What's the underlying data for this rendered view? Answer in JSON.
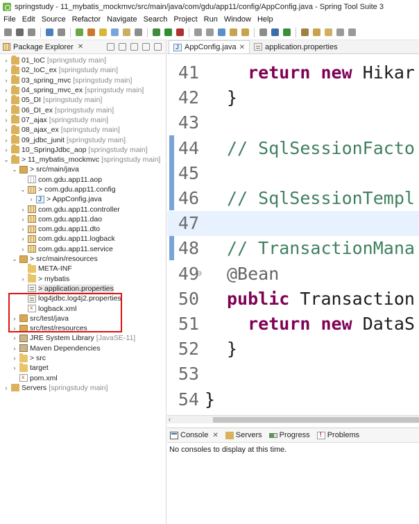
{
  "window": {
    "title": "springstudy - 11_mybatis_mockmvc/src/main/java/com/gdu/app11/config/AppConfig.java - Spring Tool Suite 3"
  },
  "menu": [
    "File",
    "Edit",
    "Source",
    "Refactor",
    "Navigate",
    "Search",
    "Project",
    "Run",
    "Window",
    "Help"
  ],
  "package_explorer": {
    "tab_label": "Package Explorer",
    "tree": [
      {
        "depth": 0,
        "twisty": ">",
        "icon": "project-icon",
        "label": "01_IoC",
        "deco": "[springstudy main]"
      },
      {
        "depth": 0,
        "twisty": ">",
        "icon": "project-icon",
        "label": "02_IoC_ex",
        "deco": "[springstudy main]"
      },
      {
        "depth": 0,
        "twisty": ">",
        "icon": "project-icon",
        "label": "03_spring_mvc",
        "deco": "[springstudy main]"
      },
      {
        "depth": 0,
        "twisty": ">",
        "icon": "project-icon",
        "label": "04_spring_mvc_ex",
        "deco": "[springstudy main]"
      },
      {
        "depth": 0,
        "twisty": ">",
        "icon": "project-icon",
        "label": "05_DI",
        "deco": "[springstudy main]"
      },
      {
        "depth": 0,
        "twisty": ">",
        "icon": "project-icon",
        "label": "06_DI_ex",
        "deco": "[springstudy main]"
      },
      {
        "depth": 0,
        "twisty": ">",
        "icon": "project-icon",
        "label": "07_ajax",
        "deco": "[springstudy main]"
      },
      {
        "depth": 0,
        "twisty": ">",
        "icon": "project-icon",
        "label": "08_ajax_ex",
        "deco": "[springstudy main]"
      },
      {
        "depth": 0,
        "twisty": ">",
        "icon": "project-icon",
        "label": "09_jdbc_junit",
        "deco": "[springstudy main]"
      },
      {
        "depth": 0,
        "twisty": ">",
        "icon": "project-icon",
        "label": "10_SpringJdbc_aop",
        "deco": "[springstudy main]"
      },
      {
        "depth": 0,
        "twisty": "v",
        "icon": "project-icon",
        "label": "> 11_mybatis_mockmvc",
        "deco": "[springstudy main]"
      },
      {
        "depth": 1,
        "twisty": "v",
        "icon": "source-folder-icon",
        "label": "> src/main/java",
        "deco": ""
      },
      {
        "depth": 2,
        "twisty": "",
        "icon": "empty-package-icon",
        "label": "com.gdu.app11.aop",
        "deco": ""
      },
      {
        "depth": 2,
        "twisty": "v",
        "icon": "package-icon",
        "label": "> com.gdu.app11.config",
        "deco": ""
      },
      {
        "depth": 3,
        "twisty": ">",
        "icon": "java-file-icon",
        "label": "> AppConfig.java",
        "deco": ""
      },
      {
        "depth": 2,
        "twisty": ">",
        "icon": "package-icon",
        "label": "com.gdu.app11.controller",
        "deco": ""
      },
      {
        "depth": 2,
        "twisty": ">",
        "icon": "package-icon",
        "label": "com.gdu.app11.dao",
        "deco": ""
      },
      {
        "depth": 2,
        "twisty": ">",
        "icon": "package-icon",
        "label": "com.gdu.app11.dto",
        "deco": ""
      },
      {
        "depth": 2,
        "twisty": ">",
        "icon": "package-icon",
        "label": "com.gdu.app11.logback",
        "deco": ""
      },
      {
        "depth": 2,
        "twisty": ">",
        "icon": "package-icon",
        "label": "com.gdu.app11.service",
        "deco": ""
      },
      {
        "depth": 1,
        "twisty": "v",
        "icon": "source-folder-icon",
        "label": "> src/main/resources",
        "deco": ""
      },
      {
        "depth": 2,
        "twisty": "",
        "icon": "folder-icon",
        "label": "META-INF",
        "deco": ""
      },
      {
        "depth": 2,
        "twisty": ">",
        "icon": "folder-icon",
        "label": "> mybatis",
        "deco": ""
      },
      {
        "depth": 2,
        "twisty": "",
        "icon": "properties-file-icon",
        "label": "> application.properties",
        "deco": "",
        "selected": true
      },
      {
        "depth": 2,
        "twisty": "",
        "icon": "properties-file-icon",
        "label": "log4jdbc.log4j2.properties",
        "deco": ""
      },
      {
        "depth": 2,
        "twisty": "",
        "icon": "xml-file-icon",
        "label": "logback.xml",
        "deco": ""
      },
      {
        "depth": 1,
        "twisty": ">",
        "icon": "source-folder-icon",
        "label": "src/test/java",
        "deco": ""
      },
      {
        "depth": 1,
        "twisty": ">",
        "icon": "source-folder-icon",
        "label": "src/test/resources",
        "deco": ""
      },
      {
        "depth": 1,
        "twisty": ">",
        "icon": "library-icon",
        "label": "JRE System Library",
        "deco": "[JavaSE-11]"
      },
      {
        "depth": 1,
        "twisty": ">",
        "icon": "library-icon",
        "label": "Maven Dependencies",
        "deco": ""
      },
      {
        "depth": 1,
        "twisty": ">",
        "icon": "folder-icon",
        "label": "> src",
        "deco": ""
      },
      {
        "depth": 1,
        "twisty": ">",
        "icon": "folder-icon",
        "label": "target",
        "deco": ""
      },
      {
        "depth": 1,
        "twisty": "",
        "icon": "xml-file-icon",
        "label": "pom.xml",
        "deco": ""
      },
      {
        "depth": 0,
        "twisty": ">",
        "icon": "servers-icon",
        "label": "Servers",
        "deco": "[springstudy main]"
      }
    ]
  },
  "editor": {
    "tabs": [
      {
        "label": "AppConfig.java",
        "icon": "java-file-icon",
        "active": true,
        "close": "✕"
      },
      {
        "label": "application.properties",
        "icon": "properties-file-icon",
        "active": false,
        "close": ""
      }
    ],
    "lines": [
      {
        "num": "41",
        "parts": [
          {
            "t": "  "
          },
          {
            "t": "return",
            "c": "kw"
          },
          {
            "t": " "
          },
          {
            "t": "new",
            "c": "kw"
          },
          {
            "t": " Hikar"
          }
        ]
      },
      {
        "num": "42",
        "parts": [
          {
            "t": "}"
          }
        ]
      },
      {
        "num": "43",
        "parts": []
      },
      {
        "num": "44",
        "parts": [
          {
            "t": "// SqlSessionFacto",
            "c": "cm"
          }
        ]
      },
      {
        "num": "45",
        "parts": []
      },
      {
        "num": "46",
        "parts": [
          {
            "t": "// SqlSessionTempl",
            "c": "cm"
          }
        ]
      },
      {
        "num": "47",
        "parts": [],
        "current": true
      },
      {
        "num": "48",
        "parts": [
          {
            "t": "// TransactionMana",
            "c": "cm"
          }
        ]
      },
      {
        "num": "49",
        "parts": [
          {
            "t": "@Bean",
            "c": "an"
          }
        ],
        "fold": "⊖"
      },
      {
        "num": "50",
        "parts": [
          {
            "t": "public",
            "c": "kw"
          },
          {
            "t": " Transaction"
          }
        ]
      },
      {
        "num": "51",
        "parts": [
          {
            "t": "  "
          },
          {
            "t": "return",
            "c": "kw"
          },
          {
            "t": " "
          },
          {
            "t": "new",
            "c": "kw"
          },
          {
            "t": " DataS"
          }
        ]
      },
      {
        "num": "52",
        "parts": [
          {
            "t": "}"
          }
        ]
      },
      {
        "num": "53",
        "parts": []
      },
      {
        "num": "54",
        "parts": [
          {
            "t": "}"
          }
        ],
        "outdent": true
      }
    ]
  },
  "bottom_panel": {
    "tabs": [
      {
        "label": "Console",
        "icon": "console-icon",
        "close": "✕"
      },
      {
        "label": "Servers",
        "icon": "servers-icon",
        "close": ""
      },
      {
        "label": "Progress",
        "icon": "progress-icon",
        "close": ""
      },
      {
        "label": "Problems",
        "icon": "problems-icon",
        "close": ""
      }
    ],
    "message": "No consoles to display at this time."
  },
  "colors": {
    "highlight_box": "#e01010",
    "keyword": "#7f0055",
    "comment": "#3f7f5f",
    "annotation": "#646464",
    "current_line": "#e8f2fe"
  }
}
